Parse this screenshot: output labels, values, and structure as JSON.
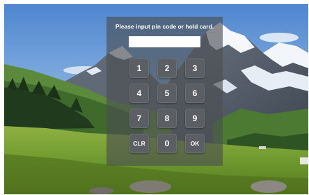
{
  "prompt": "Please input pin code or hold card.",
  "pin_input": {
    "value": "",
    "placeholder": ""
  },
  "keypad": {
    "k1": "1",
    "k2": "2",
    "k3": "3",
    "k4": "4",
    "k5": "5",
    "k6": "6",
    "k7": "7",
    "k8": "8",
    "k9": "9",
    "clear": "CLR",
    "k0": "0",
    "ok": "OK"
  },
  "colors": {
    "panel": "#4b4e52",
    "key": "#5b5e62",
    "sky": "#6f9fd6",
    "meadow": "#7fa63a"
  }
}
